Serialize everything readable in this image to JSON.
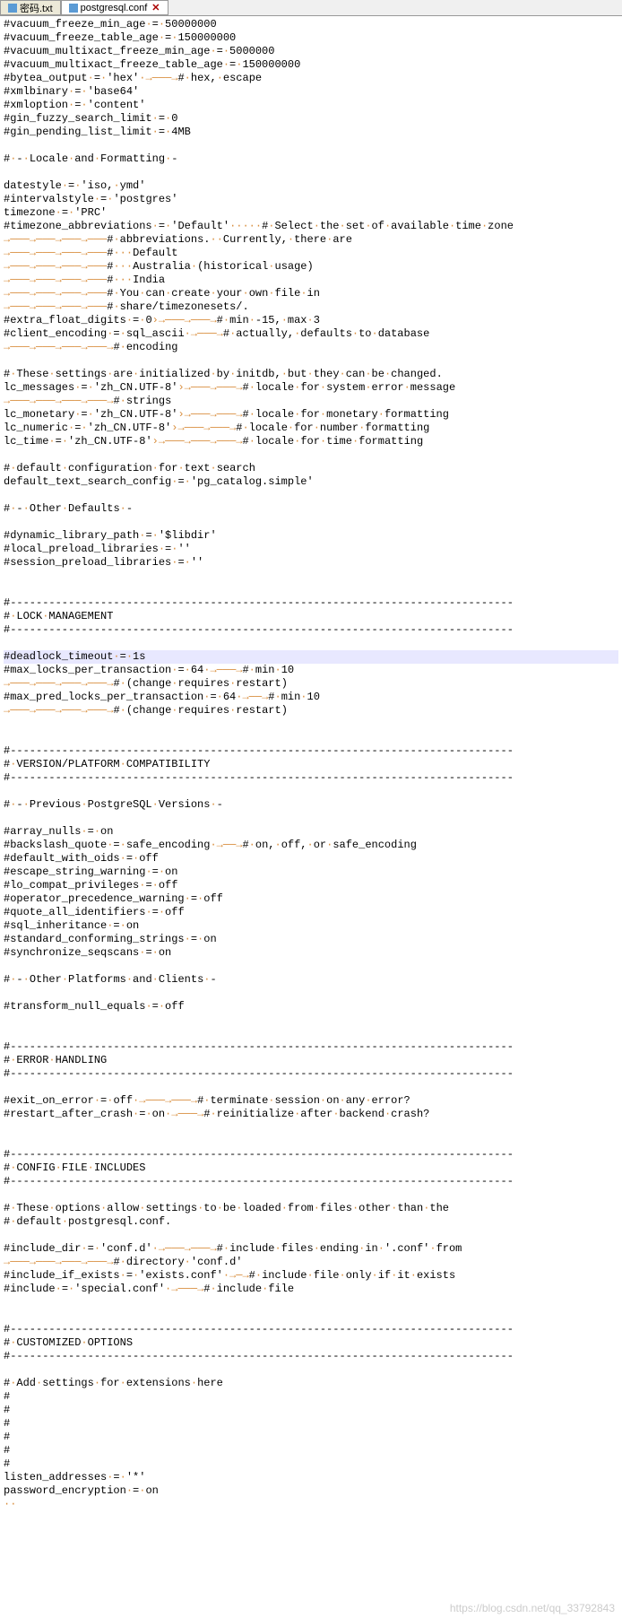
{
  "tabs": [
    {
      "label": "密码.txt",
      "active": false
    },
    {
      "label": "postgresql.conf",
      "active": true
    }
  ],
  "watermark": "https://blog.csdn.net/qq_33792843",
  "lines": [
    {
      "t": "#vacuum_freeze_min_age·=·50000000"
    },
    {
      "t": "#vacuum_freeze_table_age·=·150000000"
    },
    {
      "t": "#vacuum_multixact_freeze_min_age·=·5000000"
    },
    {
      "t": "#vacuum_multixact_freeze_table_age·=·150000000"
    },
    {
      "t": "#bytea_output·=·'hex'·→───→#·hex,·escape"
    },
    {
      "t": "#xmlbinary·=·'base64'"
    },
    {
      "t": "#xmloption·=·'content'"
    },
    {
      "t": "#gin_fuzzy_search_limit·=·0"
    },
    {
      "t": "#gin_pending_list_limit·=·4MB"
    },
    {
      "t": ""
    },
    {
      "t": "#·-·Locale·and·Formatting·-"
    },
    {
      "t": ""
    },
    {
      "t": "datestyle·=·'iso,·ymd'"
    },
    {
      "t": "#intervalstyle·=·'postgres'"
    },
    {
      "t": "timezone·=·'PRC'"
    },
    {
      "t": "#timezone_abbreviations·=·'Default'·····#·Select·the·set·of·available·time·zone"
    },
    {
      "t": "→───→───→───→───#·abbreviations.··Currently,·there·are"
    },
    {
      "t": "→───→───→───→───#···Default"
    },
    {
      "t": "→───→───→───→───#···Australia·(historical·usage)"
    },
    {
      "t": "→───→───→───→───#···India"
    },
    {
      "t": "→───→───→───→───#·You·can·create·your·own·file·in"
    },
    {
      "t": "→───→───→───→───#·share/timezonesets/."
    },
    {
      "t": "#extra_float_digits·=·0›→───→───→#·min·-15,·max·3"
    },
    {
      "t": "#client_encoding·=·sql_ascii·→───→#·actually,·defaults·to·database"
    },
    {
      "t": "→───→───→───→───→#·encoding"
    },
    {
      "t": ""
    },
    {
      "t": "#·These·settings·are·initialized·by·initdb,·but·they·can·be·changed."
    },
    {
      "t": "lc_messages·=·'zh_CN.UTF-8'›→───→───→#·locale·for·system·error·message"
    },
    {
      "t": "→───→───→───→───→#·strings"
    },
    {
      "t": "lc_monetary·=·'zh_CN.UTF-8'›→───→───→#·locale·for·monetary·formatting"
    },
    {
      "t": "lc_numeric·=·'zh_CN.UTF-8'›→───→───→#·locale·for·number·formatting"
    },
    {
      "t": "lc_time·=·'zh_CN.UTF-8'›→───→───→───→#·locale·for·time·formatting"
    },
    {
      "t": ""
    },
    {
      "t": "#·default·configuration·for·text·search"
    },
    {
      "t": "default_text_search_config·=·'pg_catalog.simple'"
    },
    {
      "t": ""
    },
    {
      "t": "#·-·Other·Defaults·-"
    },
    {
      "t": ""
    },
    {
      "t": "#dynamic_library_path·=·'$libdir'"
    },
    {
      "t": "#local_preload_libraries·=·''"
    },
    {
      "t": "#session_preload_libraries·=·''"
    },
    {
      "t": ""
    },
    {
      "t": ""
    },
    {
      "t": "#------------------------------------------------------------------------------"
    },
    {
      "t": "#·LOCK·MANAGEMENT"
    },
    {
      "t": "#------------------------------------------------------------------------------"
    },
    {
      "t": ""
    },
    {
      "t": "#deadlock_timeout·=·1s",
      "hl": true
    },
    {
      "t": "#max_locks_per_transaction·=·64·→───→#·min·10"
    },
    {
      "t": "→───→───→───→───→#·(change·requires·restart)"
    },
    {
      "t": "#max_pred_locks_per_transaction·=·64·→──→#·min·10"
    },
    {
      "t": "→───→───→───→───→#·(change·requires·restart)"
    },
    {
      "t": ""
    },
    {
      "t": ""
    },
    {
      "t": "#------------------------------------------------------------------------------"
    },
    {
      "t": "#·VERSION/PLATFORM·COMPATIBILITY"
    },
    {
      "t": "#------------------------------------------------------------------------------"
    },
    {
      "t": ""
    },
    {
      "t": "#·-·Previous·PostgreSQL·Versions·-"
    },
    {
      "t": ""
    },
    {
      "t": "#array_nulls·=·on"
    },
    {
      "t": "#backslash_quote·=·safe_encoding·→──→#·on,·off,·or·safe_encoding"
    },
    {
      "t": "#default_with_oids·=·off"
    },
    {
      "t": "#escape_string_warning·=·on"
    },
    {
      "t": "#lo_compat_privileges·=·off"
    },
    {
      "t": "#operator_precedence_warning·=·off"
    },
    {
      "t": "#quote_all_identifiers·=·off"
    },
    {
      "t": "#sql_inheritance·=·on"
    },
    {
      "t": "#standard_conforming_strings·=·on"
    },
    {
      "t": "#synchronize_seqscans·=·on"
    },
    {
      "t": ""
    },
    {
      "t": "#·-·Other·Platforms·and·Clients·-"
    },
    {
      "t": ""
    },
    {
      "t": "#transform_null_equals·=·off"
    },
    {
      "t": ""
    },
    {
      "t": ""
    },
    {
      "t": "#------------------------------------------------------------------------------"
    },
    {
      "t": "#·ERROR·HANDLING"
    },
    {
      "t": "#------------------------------------------------------------------------------"
    },
    {
      "t": ""
    },
    {
      "t": "#exit_on_error·=·off·→───→───→#·terminate·session·on·any·error?"
    },
    {
      "t": "#restart_after_crash·=·on·→───→#·reinitialize·after·backend·crash?"
    },
    {
      "t": ""
    },
    {
      "t": ""
    },
    {
      "t": "#------------------------------------------------------------------------------"
    },
    {
      "t": "#·CONFIG·FILE·INCLUDES"
    },
    {
      "t": "#------------------------------------------------------------------------------"
    },
    {
      "t": ""
    },
    {
      "t": "#·These·options·allow·settings·to·be·loaded·from·files·other·than·the"
    },
    {
      "t": "#·default·postgresql.conf."
    },
    {
      "t": ""
    },
    {
      "t": "#include_dir·=·'conf.d'·→───→───→#·include·files·ending·in·'.conf'·from"
    },
    {
      "t": "→───→───→───→───→#·directory·'conf.d'"
    },
    {
      "t": "#include_if_exists·=·'exists.conf'·→─→#·include·file·only·if·it·exists"
    },
    {
      "t": "#include·=·'special.conf'·→───→#·include·file"
    },
    {
      "t": ""
    },
    {
      "t": ""
    },
    {
      "t": "#------------------------------------------------------------------------------"
    },
    {
      "t": "#·CUSTOMIZED·OPTIONS"
    },
    {
      "t": "#------------------------------------------------------------------------------"
    },
    {
      "t": ""
    },
    {
      "t": "#·Add·settings·for·extensions·here"
    },
    {
      "t": "#"
    },
    {
      "t": "#"
    },
    {
      "t": "#"
    },
    {
      "t": "#"
    },
    {
      "t": "#"
    },
    {
      "t": "#"
    },
    {
      "t": "listen_addresses·=·'*'"
    },
    {
      "t": "password_encryption·=·on"
    },
    {
      "t": "··"
    }
  ]
}
